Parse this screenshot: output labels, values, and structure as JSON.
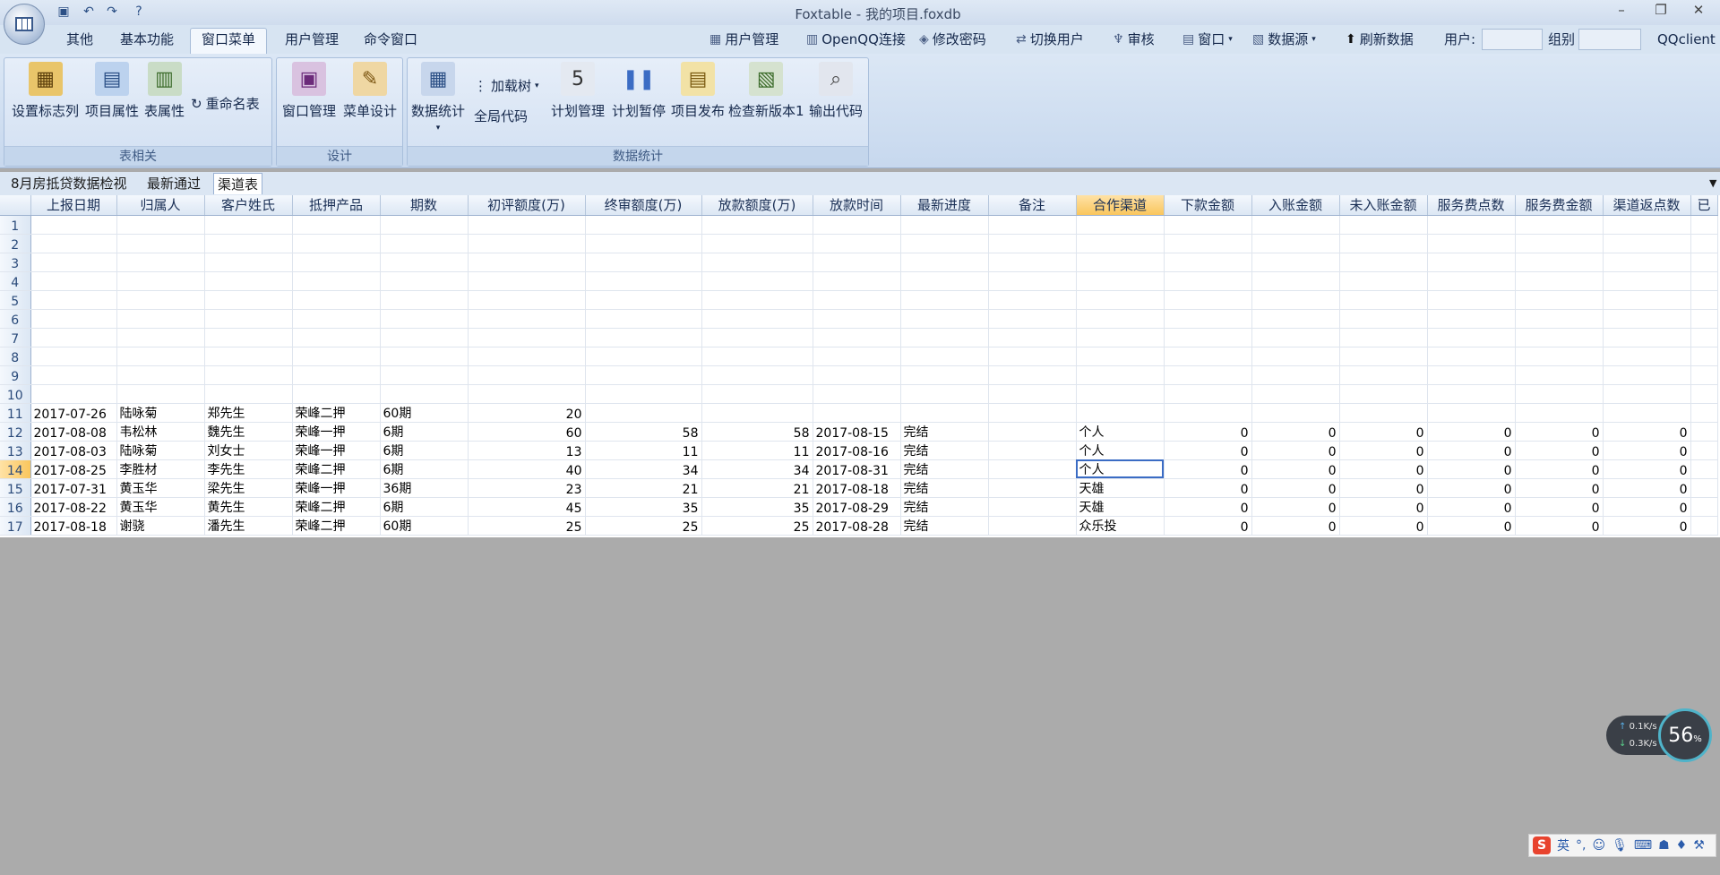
{
  "window": {
    "title": "Foxtable - 我的项目.foxdb",
    "min": "–",
    "max": "❐",
    "close": "✕"
  },
  "menu_tabs": [
    "其他",
    "基本功能",
    "窗口菜单",
    "用户管理",
    "命令窗口"
  ],
  "right_tools": {
    "user_mgmt": "用户管理",
    "openqq": "OpenQQ连接",
    "change_pwd": "修改密码",
    "switch_user": "切换用户",
    "audit": "审核",
    "window": "窗口",
    "datasource": "数据源",
    "refresh": "刷新数据",
    "user_label": "用户:",
    "group_label": "组别",
    "qqclient": "QQclient"
  },
  "ribbon": {
    "group1": {
      "caption": "表相关",
      "set_flag_col": "设置标志列",
      "project_props": "项目属性",
      "table_props": "表属性",
      "rename_table": "重命名表"
    },
    "group2": {
      "caption": "设计",
      "window_mgmt": "窗口管理",
      "menu_design": "菜单设计"
    },
    "group3": {
      "caption": "数据统计",
      "data_stats": "数据统计",
      "load_tree": "加载树",
      "global_code": "全局代码",
      "plan_mgmt": "计划管理",
      "plan_pause": "计划暂停",
      "publish": "项目发布",
      "check_version": "检查新版本1",
      "export_code": "输出代码"
    }
  },
  "sheet_tabs": [
    "8月房抵贷数据检视",
    "最新通过",
    "渠道表"
  ],
  "columns": [
    "上报日期",
    "归属人",
    "客户姓氏",
    "抵押产品",
    "期数",
    "初评额度(万)",
    "终审额度(万)",
    "放款额度(万)",
    "放款时间",
    "最新进度",
    "备注",
    "合作渠道",
    "下款金额",
    "入账金额",
    "未入账金额",
    "服务费点数",
    "服务费金额",
    "渠道返点数",
    "已"
  ],
  "rows": [
    {
      "n": "1",
      "cells": [
        "",
        "",
        "",
        "",
        "",
        "",
        "",
        "",
        "",
        "",
        "",
        "",
        "",
        "",
        "",
        "",
        "",
        "",
        ""
      ]
    },
    {
      "n": "2",
      "cells": [
        "",
        "",
        "",
        "",
        "",
        "",
        "",
        "",
        "",
        "",
        "",
        "",
        "",
        "",
        "",
        "",
        "",
        "",
        ""
      ]
    },
    {
      "n": "3",
      "cells": [
        "",
        "",
        "",
        "",
        "",
        "",
        "",
        "",
        "",
        "",
        "",
        "",
        "",
        "",
        "",
        "",
        "",
        "",
        ""
      ]
    },
    {
      "n": "4",
      "cells": [
        "",
        "",
        "",
        "",
        "",
        "",
        "",
        "",
        "",
        "",
        "",
        "",
        "",
        "",
        "",
        "",
        "",
        "",
        ""
      ]
    },
    {
      "n": "5",
      "cells": [
        "",
        "",
        "",
        "",
        "",
        "",
        "",
        "",
        "",
        "",
        "",
        "",
        "",
        "",
        "",
        "",
        "",
        "",
        ""
      ]
    },
    {
      "n": "6",
      "cells": [
        "",
        "",
        "",
        "",
        "",
        "",
        "",
        "",
        "",
        "",
        "",
        "",
        "",
        "",
        "",
        "",
        "",
        "",
        ""
      ]
    },
    {
      "n": "7",
      "cells": [
        "",
        "",
        "",
        "",
        "",
        "",
        "",
        "",
        "",
        "",
        "",
        "",
        "",
        "",
        "",
        "",
        "",
        "",
        ""
      ]
    },
    {
      "n": "8",
      "cells": [
        "",
        "",
        "",
        "",
        "",
        "",
        "",
        "",
        "",
        "",
        "",
        "",
        "",
        "",
        "",
        "",
        "",
        "",
        ""
      ]
    },
    {
      "n": "9",
      "cells": [
        "",
        "",
        "",
        "",
        "",
        "",
        "",
        "",
        "",
        "",
        "",
        "",
        "",
        "",
        "",
        "",
        "",
        "",
        ""
      ]
    },
    {
      "n": "10",
      "cells": [
        "",
        "",
        "",
        "",
        "",
        "",
        "",
        "",
        "",
        "",
        "",
        "",
        "",
        "",
        "",
        "",
        "",
        "",
        ""
      ]
    },
    {
      "n": "11",
      "cells": [
        "2017-07-26",
        "陆咏菊",
        "郑先生",
        "荣峰二押",
        "60期",
        "20",
        "",
        "",
        "",
        "",
        "",
        "",
        "",
        "",
        "",
        "",
        "",
        "",
        ""
      ]
    },
    {
      "n": "12",
      "cells": [
        "2017-08-08",
        "韦松林",
        "魏先生",
        "荣峰一押",
        "6期",
        "60",
        "58",
        "58",
        "2017-08-15",
        "完结",
        "",
        "个人",
        "0",
        "0",
        "0",
        "0",
        "0",
        "0",
        ""
      ]
    },
    {
      "n": "13",
      "cells": [
        "2017-08-03",
        "陆咏菊",
        "刘女士",
        "荣峰一押",
        "6期",
        "13",
        "11",
        "11",
        "2017-08-16",
        "完结",
        "",
        "个人",
        "0",
        "0",
        "0",
        "0",
        "0",
        "0",
        ""
      ]
    },
    {
      "n": "14",
      "cells": [
        "2017-08-25",
        "李胜材",
        "李先生",
        "荣峰二押",
        "6期",
        "40",
        "34",
        "34",
        "2017-08-31",
        "完结",
        "",
        "个人",
        "0",
        "0",
        "0",
        "0",
        "0",
        "0",
        ""
      ]
    },
    {
      "n": "15",
      "cells": [
        "2017-07-31",
        "黄玉华",
        "梁先生",
        "荣峰一押",
        "36期",
        "23",
        "21",
        "21",
        "2017-08-18",
        "完结",
        "",
        "天雄",
        "0",
        "0",
        "0",
        "0",
        "0",
        "0",
        ""
      ]
    },
    {
      "n": "16",
      "cells": [
        "2017-08-22",
        "黄玉华",
        "黄先生",
        "荣峰二押",
        "6期",
        "45",
        "35",
        "35",
        "2017-08-29",
        "完结",
        "",
        "天雄",
        "0",
        "0",
        "0",
        "0",
        "0",
        "0",
        ""
      ]
    },
    {
      "n": "17",
      "cells": [
        "2017-08-18",
        "谢骁",
        "潘先生",
        "荣峰二押",
        "60期",
        "25",
        "25",
        "25",
        "2017-08-28",
        "完结",
        "",
        "众乐投",
        "0",
        "0",
        "0",
        "0",
        "0",
        "0",
        ""
      ]
    }
  ],
  "net": {
    "up": "0.1K/s",
    "down": "0.3K/s",
    "pct": "56",
    "pct_unit": "%"
  },
  "ime": {
    "lang": "英"
  }
}
